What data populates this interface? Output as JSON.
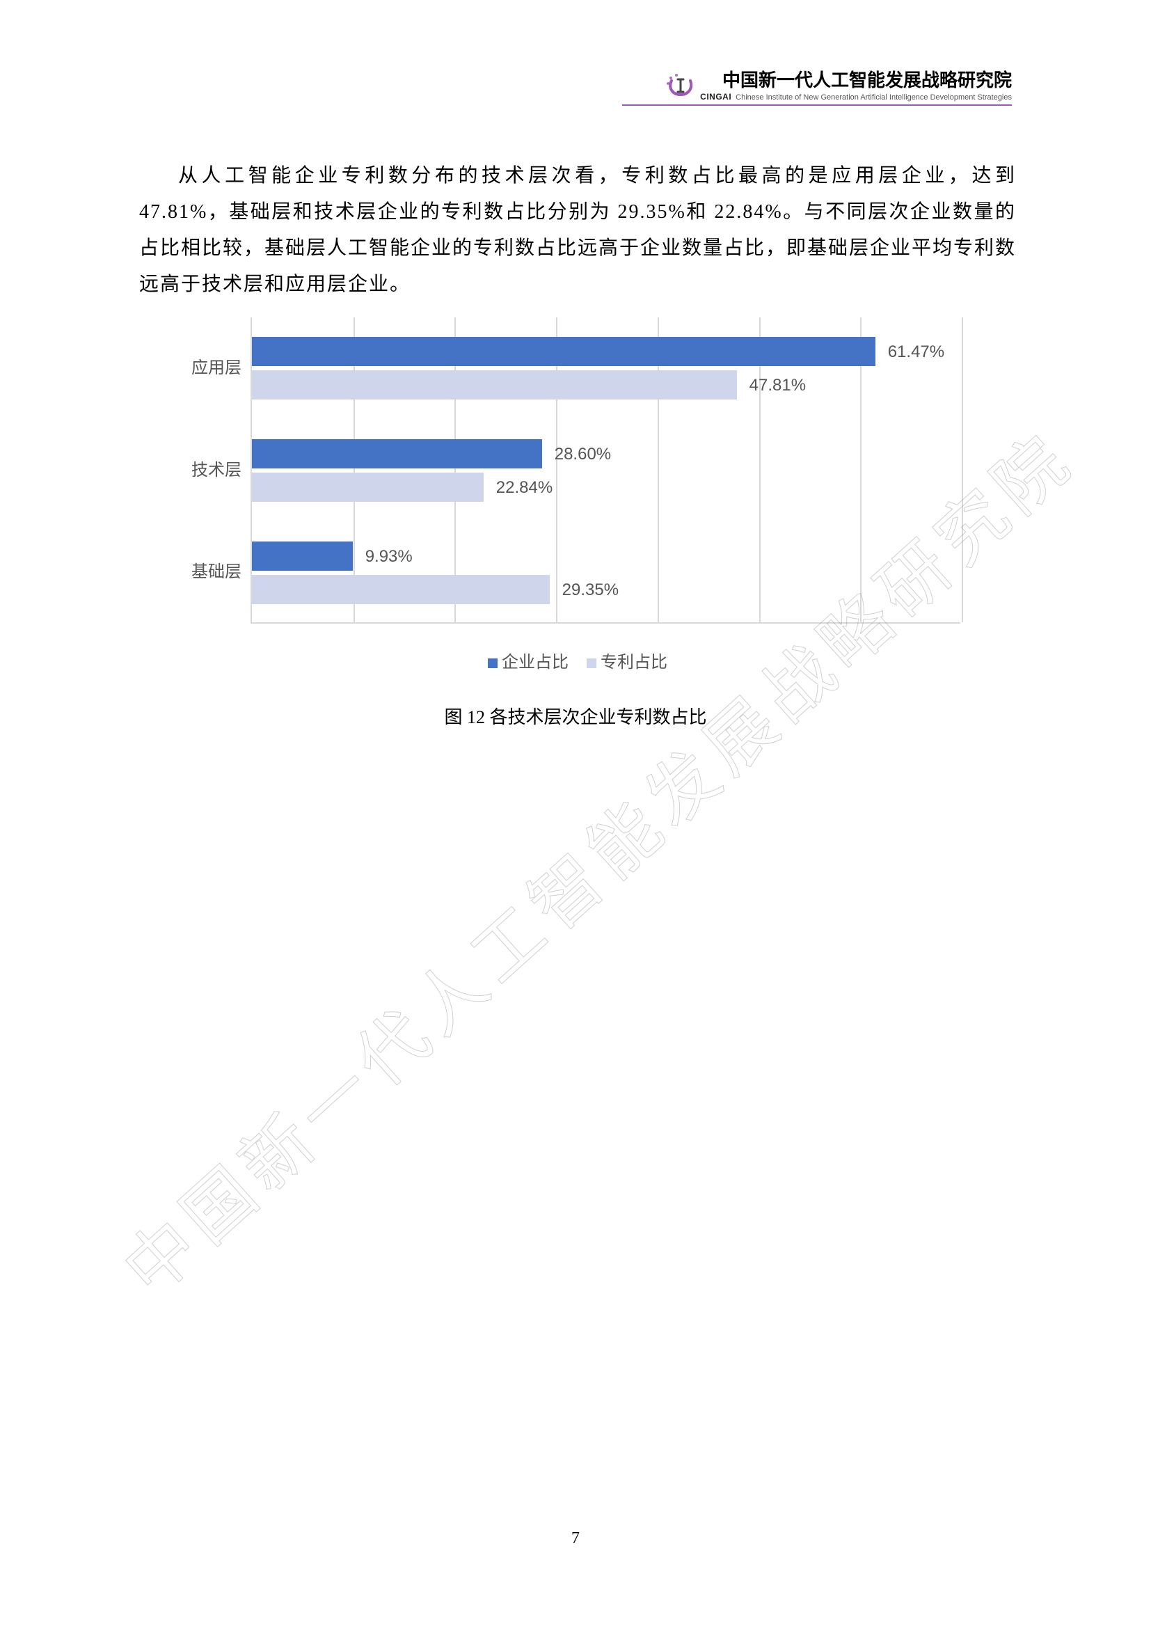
{
  "header": {
    "org_main": "中国新一代人工智能发展战略研究院",
    "org_abbr": "CINGAI",
    "org_sub_en": "Chinese Institute of New Generation Artificial Intelligence Development Strategies"
  },
  "body": {
    "paragraph": "从人工智能企业专利数分布的技术层次看，专利数占比最高的是应用层企业，达到 47.81%，基础层和技术层企业的专利数占比分别为 29.35%和 22.84%。与不同层次企业数量的占比相比较，基础层人工智能企业的专利数占比远高于企业数量占比，即基础层企业平均专利数远高于技术层和应用层企业。"
  },
  "chart_data": {
    "type": "bar",
    "orientation": "horizontal",
    "categories": [
      "应用层",
      "技术层",
      "基础层"
    ],
    "series": [
      {
        "name": "企业占比",
        "color": "#4472c4",
        "values": [
          61.47,
          28.6,
          9.93
        ]
      },
      {
        "name": "专利占比",
        "color": "#cfd5ea",
        "values": [
          47.81,
          22.84,
          29.35
        ]
      }
    ],
    "value_labels": {
      "应用层": [
        "61.47%",
        "47.81%"
      ],
      "技术层": [
        "28.60%",
        "22.84%"
      ],
      "基础层": [
        "9.93%",
        "29.35%"
      ]
    },
    "xlim": [
      0,
      70
    ],
    "xticks_pct": [
      0,
      10,
      20,
      30,
      40,
      50,
      60,
      70
    ],
    "legend": [
      "企业占比",
      "专利占比"
    ]
  },
  "caption": "图 12   各技术层次企业专利数占比",
  "watermark": "中国新一代人工智能发展战略研究院",
  "page_number": "7"
}
